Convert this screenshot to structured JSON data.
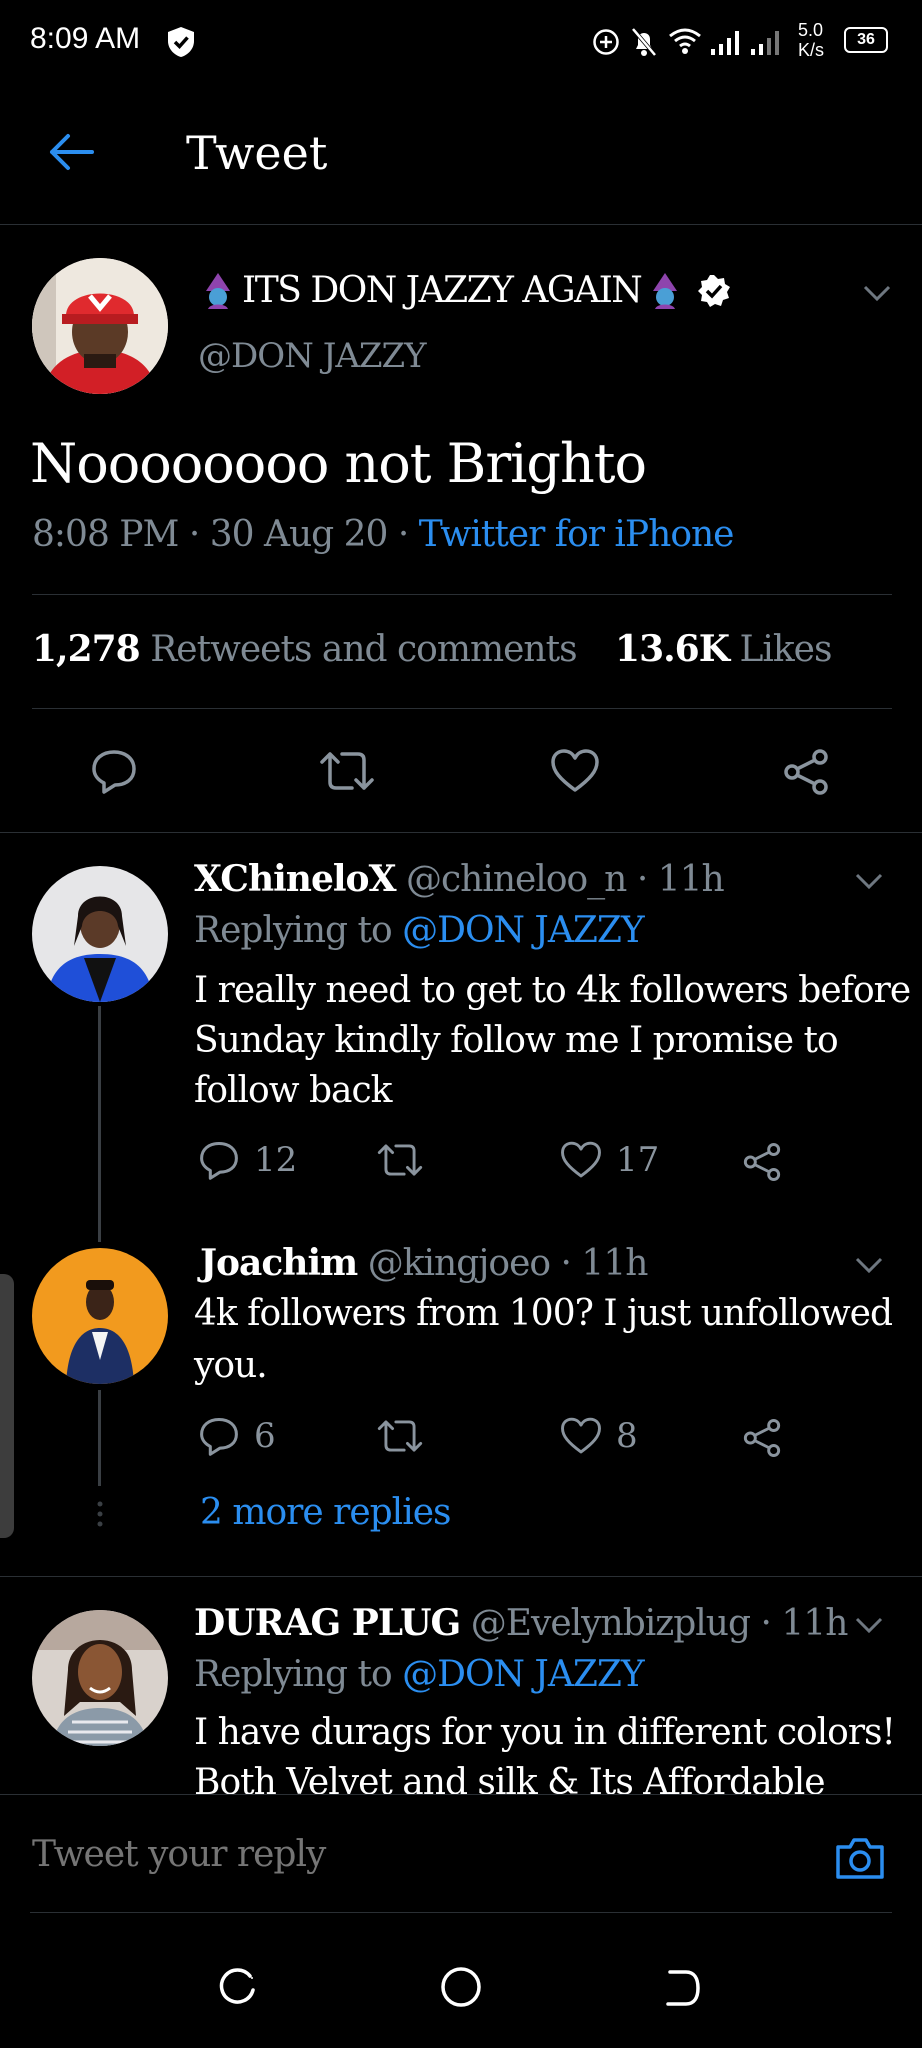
{
  "status_bar": {
    "time": "8:09 AM",
    "speed_top": "5.0",
    "speed_bottom": "K/s",
    "battery": "36"
  },
  "header": {
    "title": "Tweet"
  },
  "main_tweet": {
    "display_name": "ITS DON JAZZY AGAIN",
    "handle": "@DON JAZZY",
    "text": "Noooooooo not Brighto",
    "time": "8:08 PM",
    "date": "30 Aug 20",
    "source": "Twitter for iPhone",
    "retweets_count": "1,278",
    "retweets_label": "Retweets and comments",
    "likes_count": "13.6K",
    "likes_label": "Likes"
  },
  "replies": [
    {
      "display_name": "XChineloX",
      "handle": "@chineloo_n",
      "time": "11h",
      "replying_label": "Replying to",
      "replying_to": "@DON JAZZY",
      "text_lines": [
        "I really need to get to 4k followers before",
        "Sunday kindly follow me I promise to",
        "follow back"
      ],
      "comments": "12",
      "likes": "17"
    },
    {
      "display_name": "Joachim",
      "handle": "@kingjoeo",
      "time": "11h",
      "text_lines": [
        "4k followers from 100? I just unfollowed",
        "you."
      ],
      "comments": "6",
      "likes": "8",
      "more_replies": "2 more replies"
    },
    {
      "display_name": "DURAG PLUG",
      "handle": "@Evelynbizplug",
      "time": "11h",
      "replying_label": "Replying to",
      "replying_to": "@DON JAZZY",
      "text_lines": [
        "I have durags for you in different colors!",
        "Both Velvet and silk & Its Affordable"
      ]
    }
  ],
  "reply_bar": {
    "placeholder": "Tweet your reply"
  },
  "colors": {
    "accent": "#2b8ef0",
    "background": "#000000",
    "muted": "#7f8a94"
  }
}
